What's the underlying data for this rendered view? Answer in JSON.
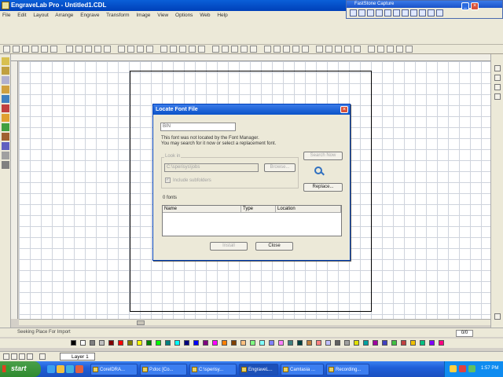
{
  "app": {
    "title": "EngraveLab Pro - Untitled1.CDL"
  },
  "menu": [
    "File",
    "Edit",
    "Layout",
    "Arrange",
    "Engrave",
    "Transform",
    "Image",
    "View",
    "Options",
    "Web",
    "Help"
  ],
  "faststone": {
    "title": "FastStone Capture"
  },
  "dialog": {
    "title": "Locate Font File",
    "font_name": "BIN",
    "message_line1": "This font was not located by the Font Manager.",
    "message_line2": "You may search for it now or select a replacement font.",
    "search_now_label": "Search Now",
    "look_in_label": "Look in",
    "look_in_path": "C:\\sperisys\\jobs",
    "browse_label": "Browse...",
    "include_subfolders_label": "Include subfolders",
    "replace_label": "Replace...",
    "fonts_count": "0 fonts",
    "columns": [
      "Name",
      "Type",
      "Location"
    ],
    "install_label": "Install",
    "close_label": "Close"
  },
  "status": {
    "text": "Seeking Place For Import",
    "zoom": "0/0"
  },
  "layer": {
    "name": "Layer 1"
  },
  "taskbar": {
    "start_label": "start",
    "tasks": [
      "CorelDRA...",
      "P.doc [Co...",
      "C:\\sperisy...",
      "EngraveL...",
      "Camtasia ...",
      "Recording..."
    ],
    "clock": "1:57 PM"
  },
  "colors": {
    "titlebar": "#0a52c8",
    "taskbar": "#1f5fd8",
    "start": "#2f8a2f",
    "palette": [
      "#000000",
      "#ffffff",
      "#808080",
      "#c0c0c0",
      "#800000",
      "#ff0000",
      "#808000",
      "#ffff00",
      "#008000",
      "#00ff00",
      "#008080",
      "#00ffff",
      "#000080",
      "#0000ff",
      "#800080",
      "#ff00ff",
      "#ff8000",
      "#804000",
      "#ffc080",
      "#80ff80",
      "#80ffff",
      "#8080ff",
      "#ff80ff",
      "#408080",
      "#004040",
      "#c08040",
      "#ff8080",
      "#c0c0ff",
      "#606060",
      "#a0a0a0",
      "#e0e000",
      "#00a0a0",
      "#a000a0",
      "#4040c0",
      "#40c040",
      "#c04040",
      "#f0c000",
      "#00c080",
      "#8000ff",
      "#ff0080"
    ]
  }
}
